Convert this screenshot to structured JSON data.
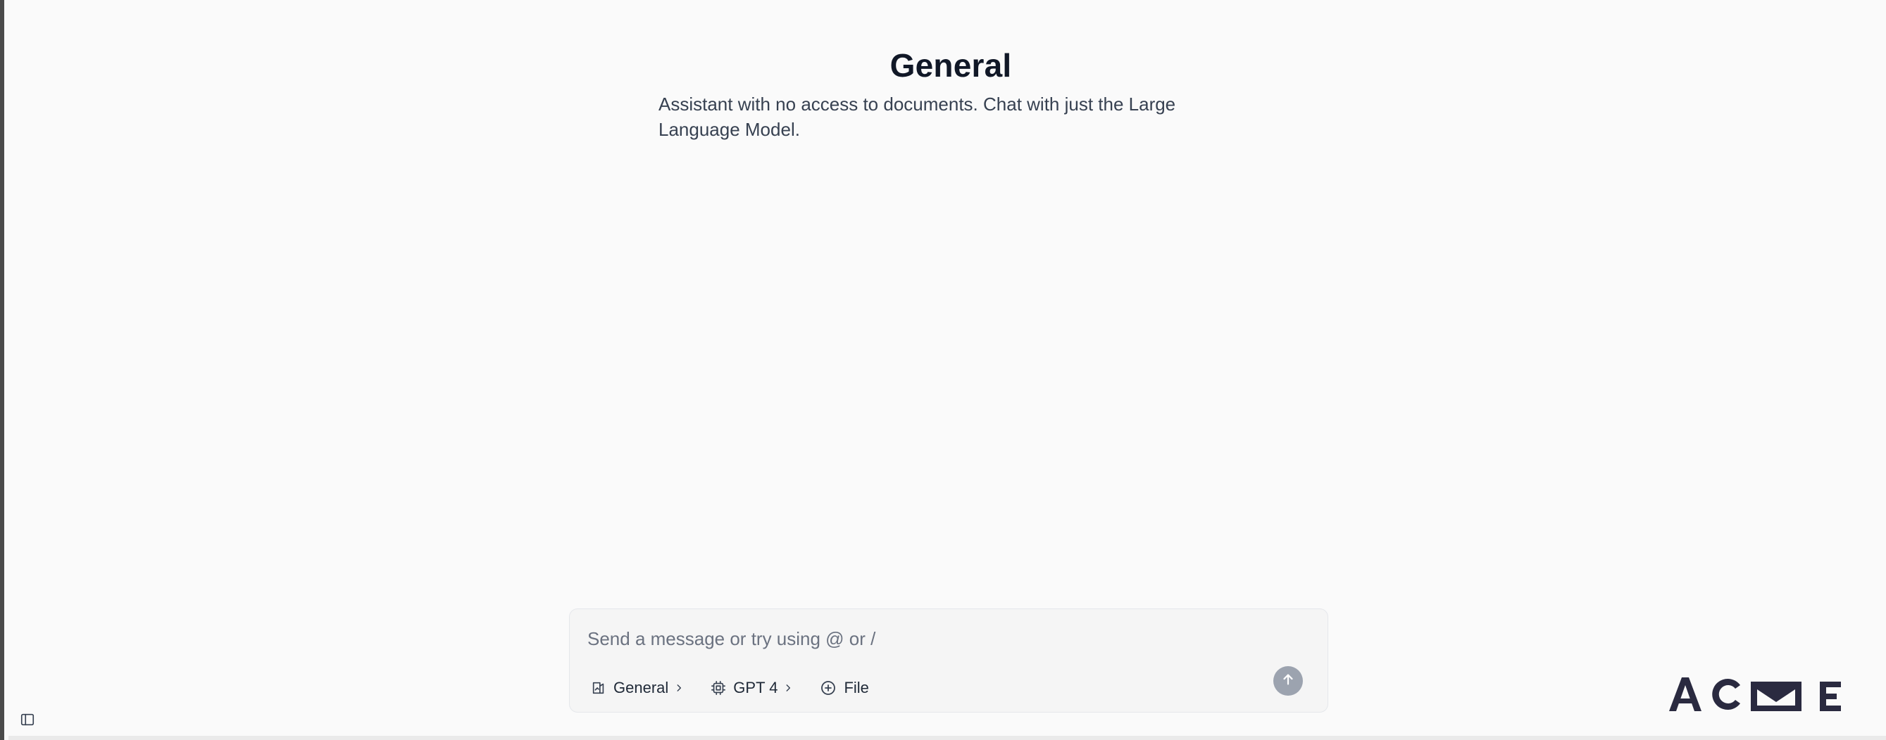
{
  "assistant": {
    "title": "General",
    "description": "Assistant with no access to documents. Chat with just the Large Language Model."
  },
  "composer": {
    "placeholder": "Send a message or try using @ or /",
    "value": "",
    "tools": {
      "assistant_label": "General",
      "model_label": "GPT 4",
      "file_label": "File"
    },
    "send_icon": "arrow-up-icon"
  },
  "sidebar": {
    "toggle_icon": "sidebar-panel-icon"
  },
  "brand": {
    "logo_text": "ACME",
    "logo_color": "#2a2a40"
  },
  "colors": {
    "background": "#fafafa",
    "composer_bg": "#f5f5f5",
    "send_button": "#9ca3af",
    "title": "#111827",
    "description": "#374151"
  }
}
